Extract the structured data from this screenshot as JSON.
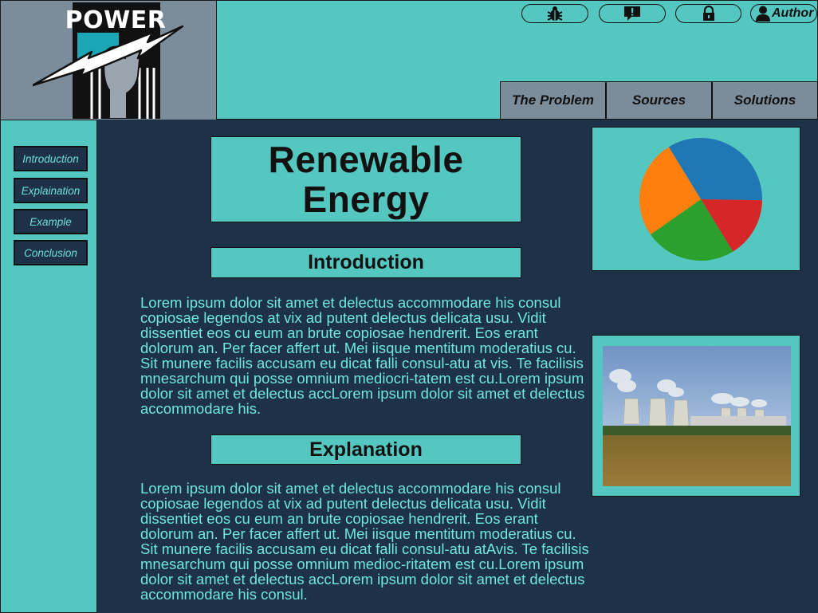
{
  "header": {
    "logo_text": "POWER",
    "util_buttons": [
      {
        "name": "bug-report",
        "icon": "bug-icon"
      },
      {
        "name": "feedback",
        "icon": "message-alert-icon"
      },
      {
        "name": "login",
        "icon": "lock-icon"
      },
      {
        "name": "author",
        "icon": "user-icon",
        "label": "Author"
      }
    ],
    "tabs": [
      "The Problem",
      "Sources",
      "Solutions"
    ]
  },
  "sidebar": {
    "items": [
      "Introduction",
      "Explaination",
      "Example",
      "Conclusion"
    ]
  },
  "main": {
    "title_line1": "Renewable",
    "title_line2": "Energy",
    "intro_heading": "Introduction",
    "intro_text": "Lorem ipsum dolor sit amet et delectus accommodare his consul copiosae legendos at vix ad putent delectus delicata usu. Vidit dissentiet eos cu eum an brute copiosae hendrerit. Eos erant dolorum an. Per facer affert ut. Mei iisque mentitum moderatius cu. Sit munere facilis accusam eu dicat falli consul-atu at vis. Te facilisis mnesarchum qui posse omnium mediocri-tatem est cu.Lorem ipsum dolor sit amet et delectus accLorem ipsum dolor sit amet et delectus accommodare his.",
    "expl_heading": "Explanation",
    "expl_text": "Lorem ipsum dolor sit amet et delectus accommodare his consul copiosae legendos at vix ad putent delectus delicata usu. Vidit dissentiet eos cu eum an brute copiosae hendrerit. Eos erant dolorum an. Per facer affert ut. Mei iisque mentitum moderatius cu. Sit munere facilis accusam eu dicat falli consul-atu atAvis. Te facilisis mnesarchum qui posse omnium medioc-ritatem est cu.Lorem ipsum dolor sit amet et delectus accLorem ipsum dolor sit amet et delectus accommodare his consul."
  },
  "colors": {
    "teal": "#54c8c0",
    "navy": "#1e3247",
    "slate": "#7b8c9b",
    "text_cyan": "#6fe8dc"
  },
  "chart_data": {
    "type": "pie",
    "values": [
      34,
      16,
      24,
      26
    ],
    "colors": [
      "#1f77b4",
      "#d62728",
      "#2ca02c",
      "#ff7f0e"
    ]
  }
}
